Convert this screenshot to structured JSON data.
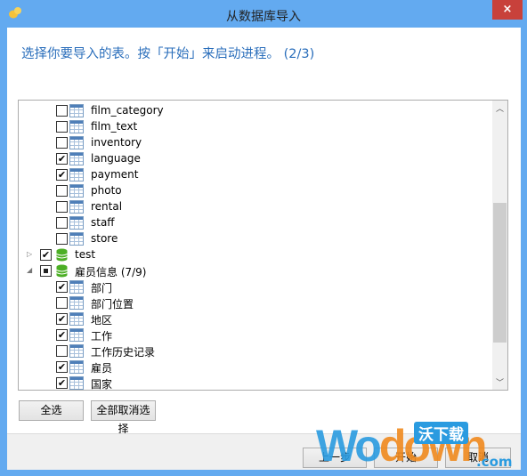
{
  "window": {
    "title": "从数据库导入",
    "close_label": "×"
  },
  "heading": "选择你要导入的表。按「开始」来启动进程。 (2/3)",
  "tree": [
    {
      "label": "film_category",
      "type": "table",
      "checked": false,
      "level": 2
    },
    {
      "label": "film_text",
      "type": "table",
      "checked": false,
      "level": 2
    },
    {
      "label": "inventory",
      "type": "table",
      "checked": false,
      "level": 2
    },
    {
      "label": "language",
      "type": "table",
      "checked": true,
      "level": 2
    },
    {
      "label": "payment",
      "type": "table",
      "checked": true,
      "level": 2
    },
    {
      "label": "photo",
      "type": "table",
      "checked": false,
      "level": 2
    },
    {
      "label": "rental",
      "type": "table",
      "checked": false,
      "level": 2
    },
    {
      "label": "staff",
      "type": "table",
      "checked": false,
      "level": 2
    },
    {
      "label": "store",
      "type": "table",
      "checked": false,
      "level": 2
    },
    {
      "label": "test",
      "type": "database",
      "checked": true,
      "level": 1,
      "expanded": false
    },
    {
      "label": "雇员信息 (7/9)",
      "type": "database",
      "checked": "partial",
      "level": 1,
      "expanded": true
    },
    {
      "label": "部门",
      "type": "table",
      "checked": true,
      "level": 2
    },
    {
      "label": "部门位置",
      "type": "table",
      "checked": false,
      "level": 2
    },
    {
      "label": "地区",
      "type": "table",
      "checked": true,
      "level": 2
    },
    {
      "label": "工作",
      "type": "table",
      "checked": true,
      "level": 2
    },
    {
      "label": "工作历史记录",
      "type": "table",
      "checked": false,
      "level": 2
    },
    {
      "label": "雇员",
      "type": "table",
      "checked": true,
      "level": 2
    },
    {
      "label": "国家",
      "type": "table",
      "checked": true,
      "level": 2
    }
  ],
  "scrollbar": {
    "position_fraction": 0.6
  },
  "buttons": {
    "select_all": "全选",
    "deselect_all": "全部取消选择",
    "back": "上一步",
    "start": "开始",
    "cancel": "取消"
  },
  "watermark": {
    "text_blue": "Wo",
    "text_orange": "down",
    "tag": "沃下载",
    "suffix": ".com"
  },
  "colors": {
    "titlebar": "#63aaf0",
    "heading": "#2a6ebb",
    "close": "#c8413b"
  }
}
